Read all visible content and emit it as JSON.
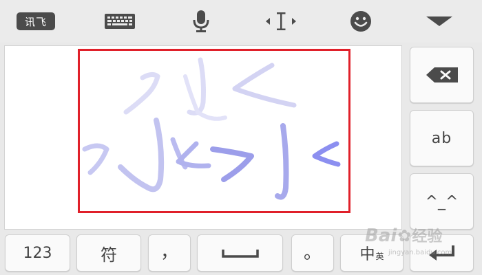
{
  "toolbar": {
    "logo_label": "讯飞",
    "icons": [
      "keyboard-icon",
      "microphone-icon",
      "text-cursor-icon",
      "emoji-face-icon",
      "collapse-triangle-icon"
    ]
  },
  "handwriting": {
    "stroke_color": "#8c8ff0",
    "highlight_color": "#e0202a"
  },
  "side_keys": {
    "ab_label": "ab",
    "kaomoji_label": "^_^"
  },
  "bottom_keys": {
    "numbers_label": "123",
    "symbols_label": "符",
    "comma_label": "，",
    "period_label": "。",
    "lang_label": "中",
    "lang_sub_label": "英"
  },
  "watermark": {
    "brand_left": "Bai",
    "brand_right": "经验",
    "url": "jingyan.baidu.com"
  },
  "colors": {
    "background": "#e9e9e9",
    "key_face": "#fafafa",
    "icon": "#4b4b4b"
  }
}
